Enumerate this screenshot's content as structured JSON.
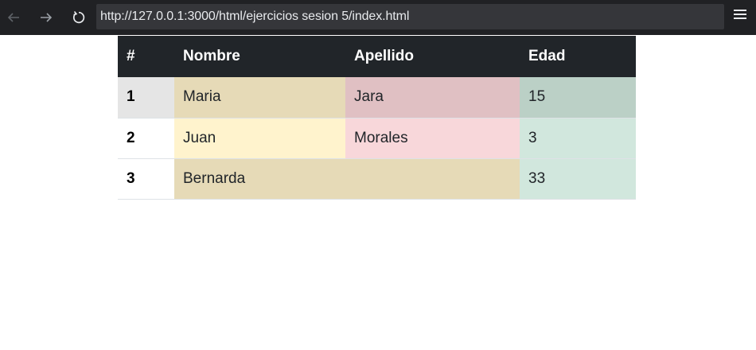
{
  "browser": {
    "url": "http://127.0.0.1:3000/html/ejercicios sesion 5/index.html"
  },
  "table": {
    "headers": [
      "#",
      "Nombre",
      "Apellido",
      "Edad"
    ],
    "rows": [
      {
        "num": "1",
        "nombre": "Maria",
        "apellido": "Jara",
        "edad": "15"
      },
      {
        "num": "2",
        "nombre": "Juan",
        "apellido": "Morales",
        "edad": "3"
      },
      {
        "num": "3",
        "nombre": "Bernarda",
        "apellido": "",
        "edad": "33"
      }
    ]
  },
  "colors": {
    "toolbar_bg": "#202124",
    "url_bar_bg": "#35363a",
    "header_bg": "#212529",
    "row1_num_bg": "#e5e5e5",
    "row1_nombre_bg": "#e6dab7",
    "row1_apellido_bg": "#e0c0c3",
    "row1_edad_bg": "#bbd0c6",
    "row2_num_bg": "#ffffff",
    "row2_nombre_bg": "#fff3cd",
    "row2_apellido_bg": "#f8d7da",
    "row2_edad_bg": "#d1e7dd",
    "row3_num_bg": "#ffffff",
    "row3_merged_bg": "#e6dab7",
    "row3_edad_bg": "#d1e7dd"
  },
  "icons": {
    "back": "arrow-left-icon",
    "forward": "arrow-right-icon",
    "reload": "reload-icon",
    "menu": "hamburger-menu-icon"
  }
}
